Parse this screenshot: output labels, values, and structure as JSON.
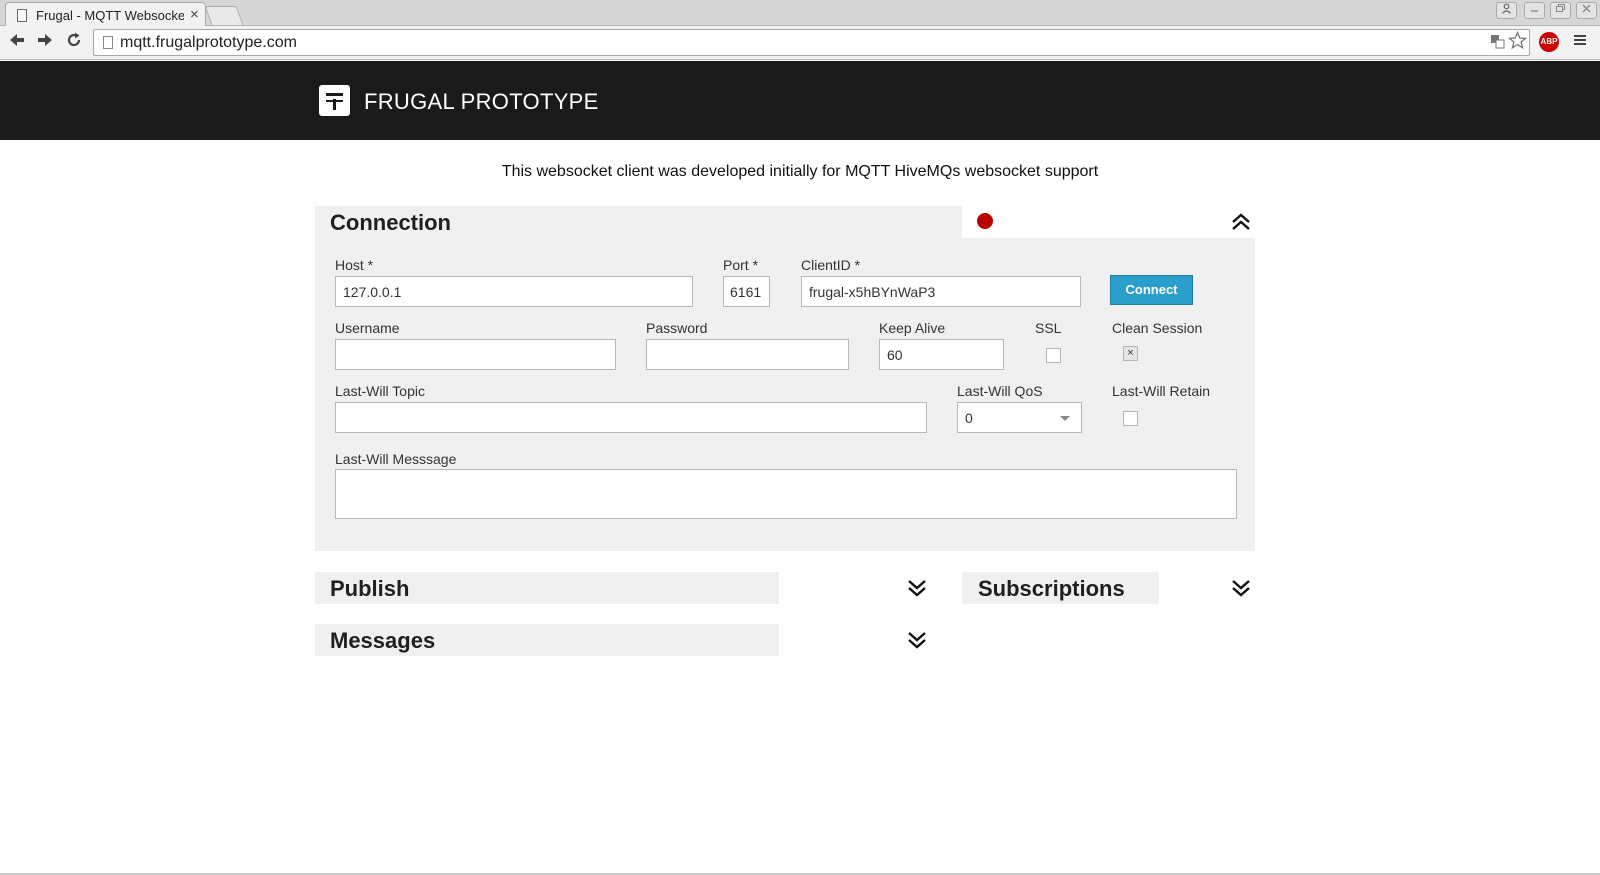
{
  "browser": {
    "tab_title": "Frugal - MQTT Websocke",
    "tab_close": "×",
    "url": "mqtt.frugalprototype.com",
    "abp_label": "ABP",
    "icons": [
      "back-arrow-icon",
      "forward-arrow-icon",
      "reload-icon",
      "page-icon",
      "translate-icon",
      "star-icon",
      "adblock-icon",
      "menu-icon",
      "user-icon",
      "minimize-icon",
      "restore-icon",
      "close-icon"
    ]
  },
  "header": {
    "brand": "FRUGAL PROTOTYPE"
  },
  "intro": "This websocket client was developed initially for MQTT HiveMQs websocket support",
  "connection": {
    "title": "Connection",
    "status_color": "#bb0000",
    "host_label": "Host *",
    "host_value": "127.0.0.1",
    "port_label": "Port *",
    "port_value": "6161",
    "clientid_label": "ClientID *",
    "clientid_value": "frugal-x5hBYnWaP3",
    "connect_label": "Connect",
    "username_label": "Username",
    "username_value": "",
    "password_label": "Password",
    "password_value": "",
    "keepalive_label": "Keep Alive",
    "keepalive_value": "60",
    "ssl_label": "SSL",
    "ssl_checked": false,
    "clean_session_label": "Clean Session",
    "clean_session_checked": true,
    "clean_session_mark": "×",
    "lwt_topic_label": "Last-Will Topic",
    "lwt_topic_value": "",
    "lwt_qos_label": "Last-Will QoS",
    "lwt_qos_value": "0",
    "lwt_retain_label": "Last-Will Retain",
    "lwt_retain_checked": false,
    "lwt_message_label": "Last-Will Messsage",
    "lwt_message_value": ""
  },
  "sections": {
    "publish": "Publish",
    "subscriptions": "Subscriptions",
    "messages": "Messages"
  },
  "colors": {
    "header_bg": "#1a1a1a",
    "panel_bg": "#f0f0f0",
    "connect_button": "#2a9fcc"
  }
}
